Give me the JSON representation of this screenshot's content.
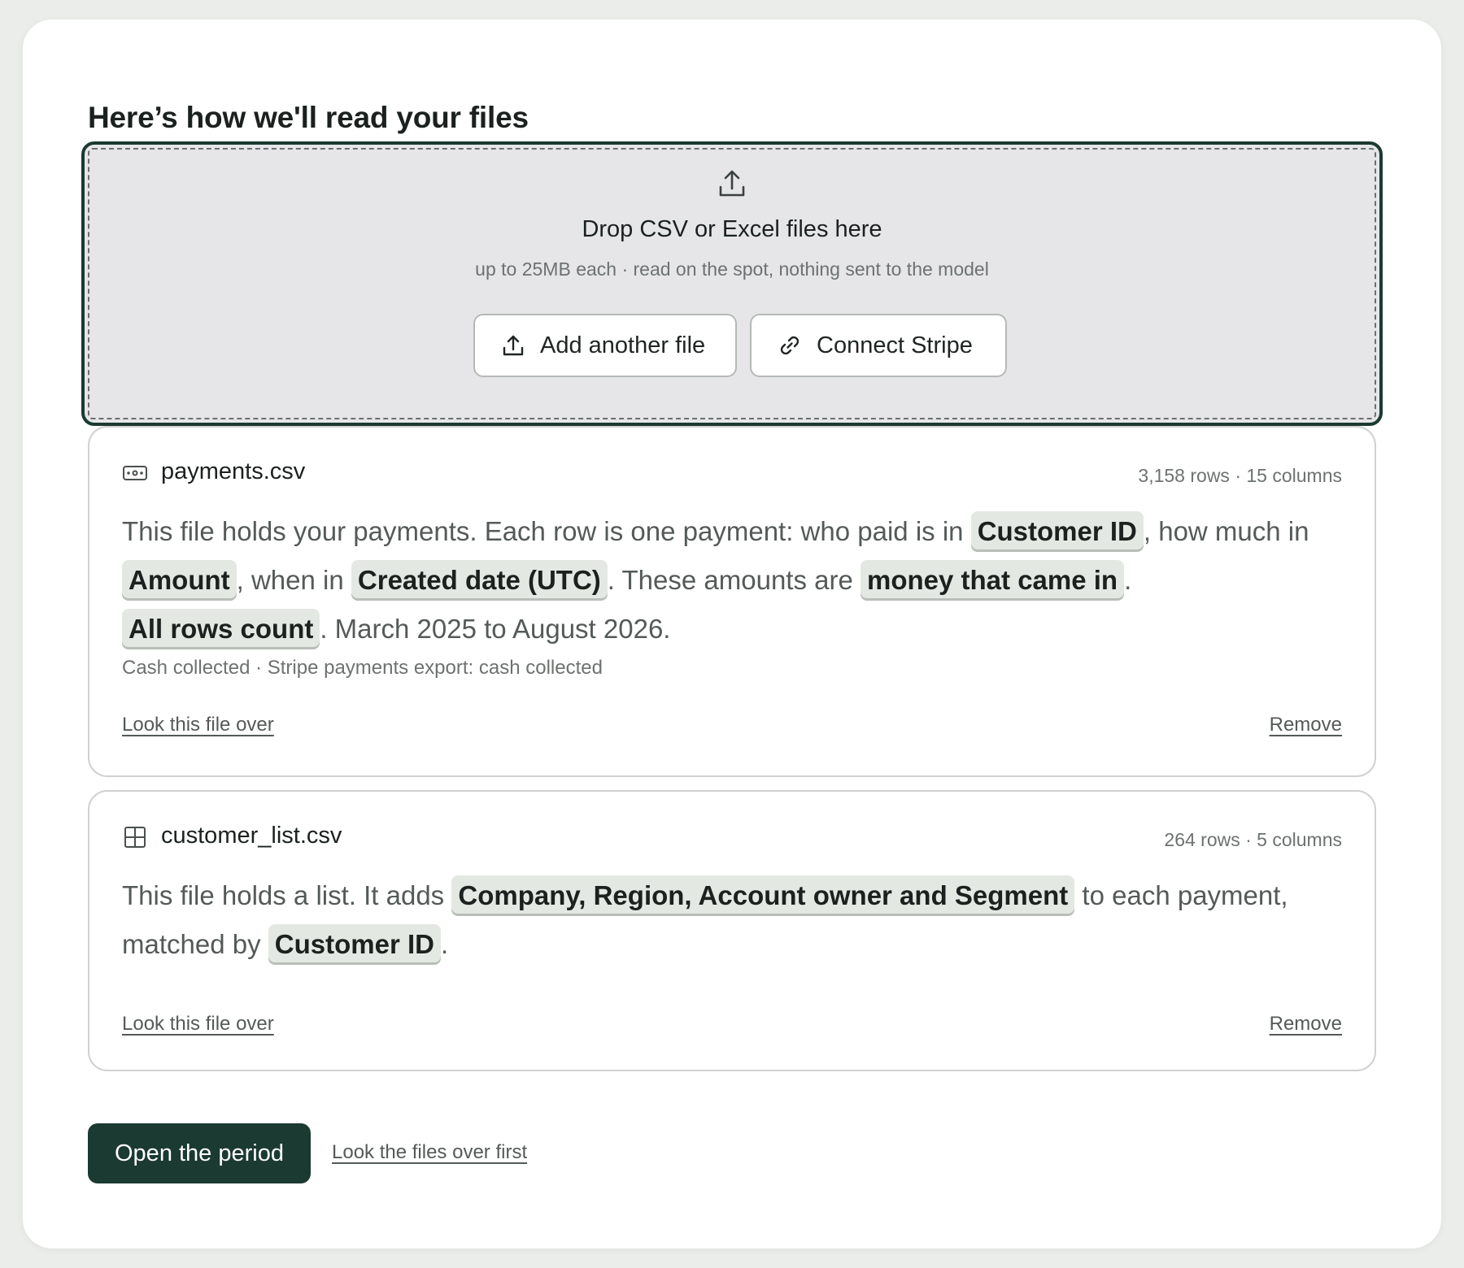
{
  "page": {
    "title": "Here’s how we'll read your files"
  },
  "dropzone": {
    "title": "Drop CSV or Excel files here",
    "subtitle": "up to 25MB each · read on the spot, nothing sent to the model",
    "icon": "upload-icon",
    "buttons": {
      "add_file": {
        "label": "Add another file",
        "icon": "upload-icon"
      },
      "connect_stripe": {
        "label": "Connect Stripe",
        "icon": "link-icon"
      }
    }
  },
  "files": [
    {
      "name": "payments.csv",
      "icon": "money-icon",
      "meta": "3,158 rows · 15 columns",
      "desc": {
        "t1": "This file holds your payments. Each row is one payment: who paid is in ",
        "c1": "Customer ID",
        "t2": ", how much in ",
        "c2": "Amount",
        "t3": ", when in ",
        "c3": "Created date (UTC)",
        "t4": ". These amounts are ",
        "c4": "money that came in",
        "t5": ". ",
        "c5": "All rows count",
        "t6": ". March 2025 to August 2026."
      },
      "note": "Cash collected · Stripe payments export: cash collected",
      "review_link": "Look this file over",
      "remove_link": "Remove"
    },
    {
      "name": "customer_list.csv",
      "icon": "table-icon",
      "meta": "264 rows · 5 columns",
      "desc": {
        "t1": "This file holds a list. It adds ",
        "c1": "Company, Region, Account owner and Segment",
        "t2": " to each payment, matched by ",
        "c2": "Customer ID",
        "t3": "."
      },
      "review_link": "Look this file over",
      "remove_link": "Remove"
    }
  ],
  "footer": {
    "primary_button": "Open the period",
    "secondary_link": "Look the files over first"
  },
  "colors": {
    "accent": "#1b3a31",
    "chip_bg": "#e4e8e3",
    "dropzone_bg": "#e6e6e9"
  }
}
